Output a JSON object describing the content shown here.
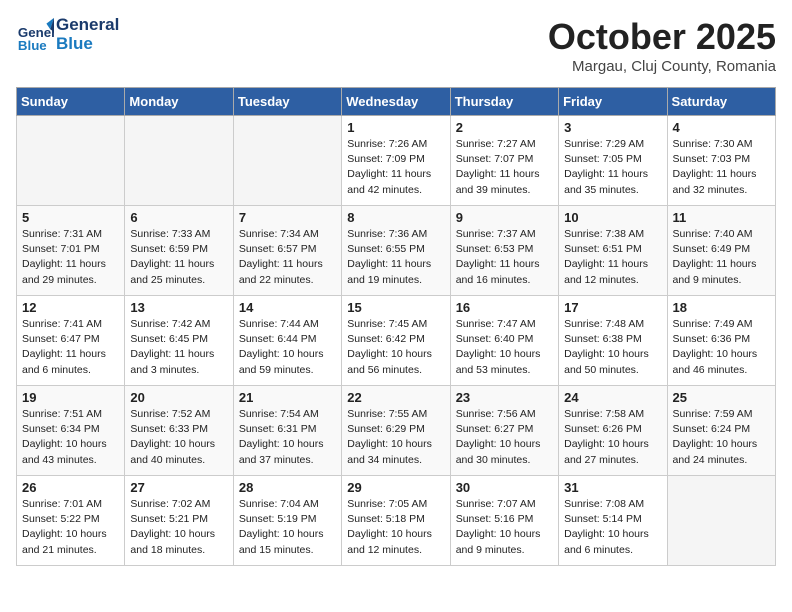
{
  "header": {
    "logo_general": "General",
    "logo_blue": "Blue",
    "month": "October 2025",
    "location": "Margau, Cluj County, Romania"
  },
  "weekdays": [
    "Sunday",
    "Monday",
    "Tuesday",
    "Wednesday",
    "Thursday",
    "Friday",
    "Saturday"
  ],
  "weeks": [
    [
      {
        "day": "",
        "info": ""
      },
      {
        "day": "",
        "info": ""
      },
      {
        "day": "",
        "info": ""
      },
      {
        "day": "1",
        "info": "Sunrise: 7:26 AM\nSunset: 7:09 PM\nDaylight: 11 hours\nand 42 minutes."
      },
      {
        "day": "2",
        "info": "Sunrise: 7:27 AM\nSunset: 7:07 PM\nDaylight: 11 hours\nand 39 minutes."
      },
      {
        "day": "3",
        "info": "Sunrise: 7:29 AM\nSunset: 7:05 PM\nDaylight: 11 hours\nand 35 minutes."
      },
      {
        "day": "4",
        "info": "Sunrise: 7:30 AM\nSunset: 7:03 PM\nDaylight: 11 hours\nand 32 minutes."
      }
    ],
    [
      {
        "day": "5",
        "info": "Sunrise: 7:31 AM\nSunset: 7:01 PM\nDaylight: 11 hours\nand 29 minutes."
      },
      {
        "day": "6",
        "info": "Sunrise: 7:33 AM\nSunset: 6:59 PM\nDaylight: 11 hours\nand 25 minutes."
      },
      {
        "day": "7",
        "info": "Sunrise: 7:34 AM\nSunset: 6:57 PM\nDaylight: 11 hours\nand 22 minutes."
      },
      {
        "day": "8",
        "info": "Sunrise: 7:36 AM\nSunset: 6:55 PM\nDaylight: 11 hours\nand 19 minutes."
      },
      {
        "day": "9",
        "info": "Sunrise: 7:37 AM\nSunset: 6:53 PM\nDaylight: 11 hours\nand 16 minutes."
      },
      {
        "day": "10",
        "info": "Sunrise: 7:38 AM\nSunset: 6:51 PM\nDaylight: 11 hours\nand 12 minutes."
      },
      {
        "day": "11",
        "info": "Sunrise: 7:40 AM\nSunset: 6:49 PM\nDaylight: 11 hours\nand 9 minutes."
      }
    ],
    [
      {
        "day": "12",
        "info": "Sunrise: 7:41 AM\nSunset: 6:47 PM\nDaylight: 11 hours\nand 6 minutes."
      },
      {
        "day": "13",
        "info": "Sunrise: 7:42 AM\nSunset: 6:45 PM\nDaylight: 11 hours\nand 3 minutes."
      },
      {
        "day": "14",
        "info": "Sunrise: 7:44 AM\nSunset: 6:44 PM\nDaylight: 10 hours\nand 59 minutes."
      },
      {
        "day": "15",
        "info": "Sunrise: 7:45 AM\nSunset: 6:42 PM\nDaylight: 10 hours\nand 56 minutes."
      },
      {
        "day": "16",
        "info": "Sunrise: 7:47 AM\nSunset: 6:40 PM\nDaylight: 10 hours\nand 53 minutes."
      },
      {
        "day": "17",
        "info": "Sunrise: 7:48 AM\nSunset: 6:38 PM\nDaylight: 10 hours\nand 50 minutes."
      },
      {
        "day": "18",
        "info": "Sunrise: 7:49 AM\nSunset: 6:36 PM\nDaylight: 10 hours\nand 46 minutes."
      }
    ],
    [
      {
        "day": "19",
        "info": "Sunrise: 7:51 AM\nSunset: 6:34 PM\nDaylight: 10 hours\nand 43 minutes."
      },
      {
        "day": "20",
        "info": "Sunrise: 7:52 AM\nSunset: 6:33 PM\nDaylight: 10 hours\nand 40 minutes."
      },
      {
        "day": "21",
        "info": "Sunrise: 7:54 AM\nSunset: 6:31 PM\nDaylight: 10 hours\nand 37 minutes."
      },
      {
        "day": "22",
        "info": "Sunrise: 7:55 AM\nSunset: 6:29 PM\nDaylight: 10 hours\nand 34 minutes."
      },
      {
        "day": "23",
        "info": "Sunrise: 7:56 AM\nSunset: 6:27 PM\nDaylight: 10 hours\nand 30 minutes."
      },
      {
        "day": "24",
        "info": "Sunrise: 7:58 AM\nSunset: 6:26 PM\nDaylight: 10 hours\nand 27 minutes."
      },
      {
        "day": "25",
        "info": "Sunrise: 7:59 AM\nSunset: 6:24 PM\nDaylight: 10 hours\nand 24 minutes."
      }
    ],
    [
      {
        "day": "26",
        "info": "Sunrise: 7:01 AM\nSunset: 5:22 PM\nDaylight: 10 hours\nand 21 minutes."
      },
      {
        "day": "27",
        "info": "Sunrise: 7:02 AM\nSunset: 5:21 PM\nDaylight: 10 hours\nand 18 minutes."
      },
      {
        "day": "28",
        "info": "Sunrise: 7:04 AM\nSunset: 5:19 PM\nDaylight: 10 hours\nand 15 minutes."
      },
      {
        "day": "29",
        "info": "Sunrise: 7:05 AM\nSunset: 5:18 PM\nDaylight: 10 hours\nand 12 minutes."
      },
      {
        "day": "30",
        "info": "Sunrise: 7:07 AM\nSunset: 5:16 PM\nDaylight: 10 hours\nand 9 minutes."
      },
      {
        "day": "31",
        "info": "Sunrise: 7:08 AM\nSunset: 5:14 PM\nDaylight: 10 hours\nand 6 minutes."
      },
      {
        "day": "",
        "info": ""
      }
    ]
  ]
}
